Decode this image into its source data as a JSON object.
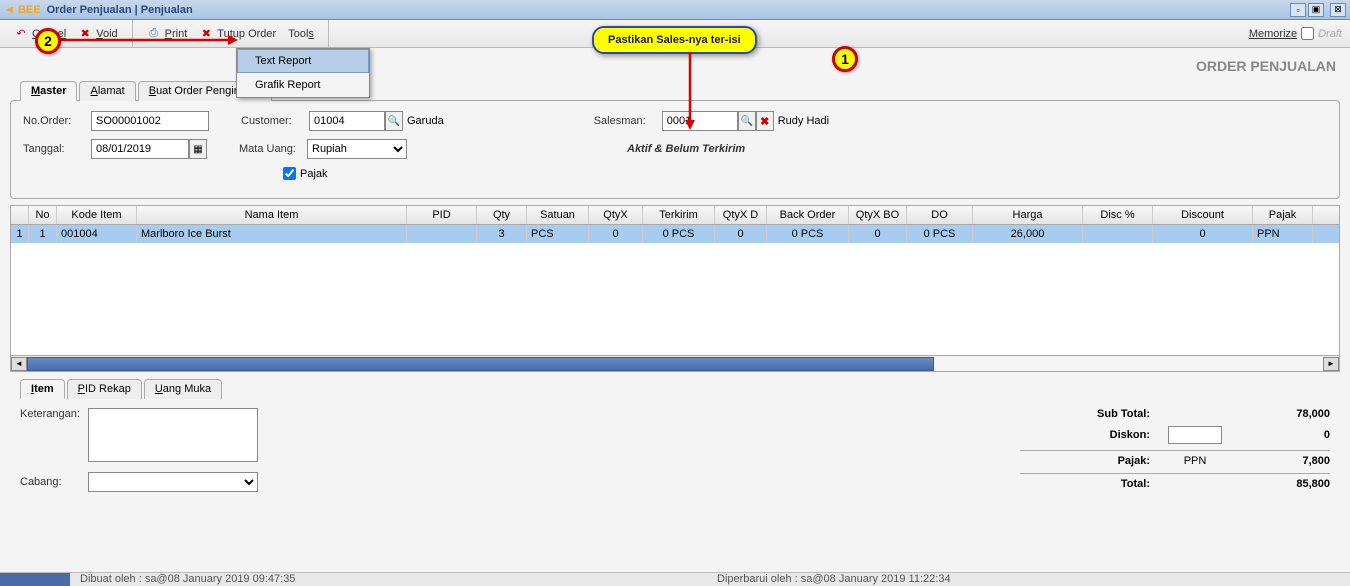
{
  "window": {
    "title": "Order Penjualan | Penjualan",
    "logo": "BEE"
  },
  "toolbar": {
    "cancel": "Cancel",
    "void": "Void",
    "print": "Print",
    "tutup": "Tutup Order",
    "tools": "Tools",
    "memorize": "Memorize",
    "draft": "Draft"
  },
  "dropdown": {
    "text_report": "Text Report",
    "grafik_report": "Grafik Report"
  },
  "page_title": "ORDER PENJUALAN",
  "tabs_top": {
    "master": "Master",
    "alamat": "Alamat",
    "buat": "Buat Order Pengiriman"
  },
  "form": {
    "no_order_lbl": "No.Order:",
    "no_order": "SO00001002",
    "tanggal_lbl": "Tanggal:",
    "tanggal": "08/01/2019",
    "customer_lbl": "Customer:",
    "customer": "01004",
    "customer_name": "Garuda",
    "mata_uang_lbl": "Mata Uang:",
    "mata_uang": "Rupiah",
    "pajak_lbl": "Pajak",
    "salesman_lbl": "Salesman:",
    "salesman": "0001",
    "salesman_name": "Rudy Hadi",
    "status": "Aktif & Belum Terkirim"
  },
  "grid": {
    "headers": {
      "no": "No",
      "kode": "Kode Item",
      "nama": "Nama Item",
      "pid": "PID",
      "qty": "Qty",
      "satuan": "Satuan",
      "qtyx": "QtyX",
      "terkirim": "Terkirim",
      "qtyxd": "QtyX D",
      "backorder": "Back Order",
      "qtyxbo": "QtyX BO",
      "do": "DO",
      "harga": "Harga",
      "discp": "Disc %",
      "discount": "Discount",
      "pajak": "Pajak"
    },
    "rows": [
      {
        "rn": "1",
        "no": "1",
        "kode": "001004",
        "nama": "Marlboro Ice Burst",
        "pid": "",
        "qty": "3",
        "satuan": "PCS",
        "qtyx": "0",
        "terkirim": "0 PCS",
        "qtyxd": "0",
        "backorder": "0 PCS",
        "qtyxbo": "0",
        "do": "0 PCS",
        "harga": "26,000",
        "discp": "",
        "discount": "0",
        "pajak": "PPN"
      }
    ]
  },
  "tabs_bottom": {
    "item": "Item",
    "pid": "PID Rekap",
    "uang": "Uang Muka"
  },
  "footer": {
    "keterangan_lbl": "Keterangan:",
    "keterangan": "",
    "cabang_lbl": "Cabang:",
    "cabang": "",
    "subtotal_lbl": "Sub Total:",
    "subtotal": "78,000",
    "diskon_lbl": "Diskon:",
    "diskon_val": "0",
    "pajak_lbl": "Pajak:",
    "pajak_mid": "PPN",
    "pajak_val": "7,800",
    "total_lbl": "Total:",
    "total": "85,800"
  },
  "status": {
    "dibuat": "Dibuat oleh : sa@08 January 2019  09:47:35",
    "diperbarui": "Diperbarui oleh : sa@08 January 2019  11:22:34"
  },
  "annot": {
    "callout": "Pastikan Sales-nya ter-isi",
    "badge1": "1",
    "badge2": "2"
  }
}
